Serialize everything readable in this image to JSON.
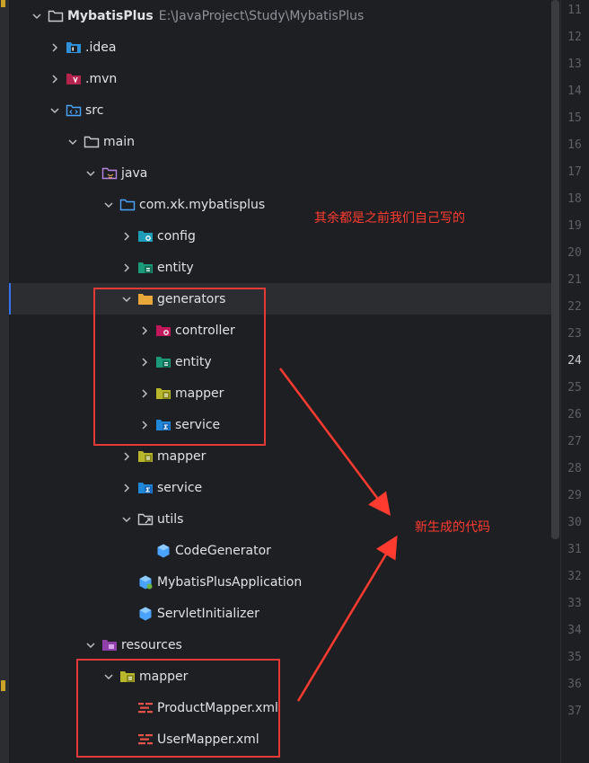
{
  "project": {
    "name": "MybatisPlus",
    "path": "E:\\JavaProject\\Study\\MybatisPlus"
  },
  "tree": [
    {
      "label": "MybatisPlus",
      "depth": 0,
      "icon": "folder-icon",
      "chevron": "down",
      "bold": true
    },
    {
      "label": ".idea",
      "depth": 1,
      "icon": "idea-folder-icon",
      "chevron": "right"
    },
    {
      "label": ".mvn",
      "depth": 1,
      "icon": "mvn-folder-icon",
      "chevron": "right"
    },
    {
      "label": "src",
      "depth": 1,
      "icon": "source-folder-icon",
      "chevron": "down"
    },
    {
      "label": "main",
      "depth": 2,
      "icon": "folder-icon",
      "chevron": "down"
    },
    {
      "label": "java",
      "depth": 3,
      "icon": "java-source-root-icon",
      "chevron": "down"
    },
    {
      "label": "com.xk.mybatisplus",
      "depth": 4,
      "icon": "package-icon",
      "chevron": "down"
    },
    {
      "label": "config",
      "depth": 5,
      "icon": "config-package-icon",
      "chevron": "right"
    },
    {
      "label": "entity",
      "depth": 5,
      "icon": "entity-package-icon",
      "chevron": "right"
    },
    {
      "label": "generators",
      "depth": 5,
      "icon": "generators-folder-icon",
      "chevron": "down",
      "selected": true
    },
    {
      "label": "controller",
      "depth": 6,
      "icon": "controller-package-icon",
      "chevron": "right"
    },
    {
      "label": "entity",
      "depth": 6,
      "icon": "entity-package-icon",
      "chevron": "right"
    },
    {
      "label": "mapper",
      "depth": 6,
      "icon": "mapper-package-icon",
      "chevron": "right"
    },
    {
      "label": "service",
      "depth": 6,
      "icon": "service-package-icon",
      "chevron": "right"
    },
    {
      "label": "mapper",
      "depth": 5,
      "icon": "mapper-package-icon",
      "chevron": "right"
    },
    {
      "label": "service",
      "depth": 5,
      "icon": "service-package-icon",
      "chevron": "right"
    },
    {
      "label": "utils",
      "depth": 5,
      "icon": "utils-package-icon",
      "chevron": "down"
    },
    {
      "label": "CodeGenerator",
      "depth": 6,
      "icon": "java-class-icon",
      "chevron": "none"
    },
    {
      "label": "MybatisPlusApplication",
      "depth": 5,
      "icon": "spring-boot-class-icon",
      "chevron": "none"
    },
    {
      "label": "ServletInitializer",
      "depth": 5,
      "icon": "java-class-icon",
      "chevron": "none"
    },
    {
      "label": "resources",
      "depth": 3,
      "icon": "resources-root-icon",
      "chevron": "down"
    },
    {
      "label": "mapper",
      "depth": 4,
      "icon": "mapper-package-icon",
      "chevron": "down"
    },
    {
      "label": "ProductMapper.xml",
      "depth": 5,
      "icon": "xml-mapper-icon",
      "chevron": "none"
    },
    {
      "label": "UserMapper.xml",
      "depth": 5,
      "icon": "xml-mapper-icon",
      "chevron": "none"
    }
  ],
  "line_numbers": [
    "11",
    "12",
    "13",
    "14",
    "15",
    "16",
    "17",
    "18",
    "19",
    "20",
    "21",
    "22",
    "23",
    "24",
    "25",
    "26",
    "27",
    "28",
    "29",
    "30",
    "31",
    "32",
    "33",
    "34",
    "35",
    "36",
    "37"
  ],
  "current_line": "24",
  "annotations": {
    "rest_written_by_us": "其余都是之前我们自己写的",
    "newly_generated_code": "新生成的代码"
  },
  "colors": {
    "accent": "#3574f0",
    "annotation": "#e53935",
    "background": "#1e1f22"
  }
}
